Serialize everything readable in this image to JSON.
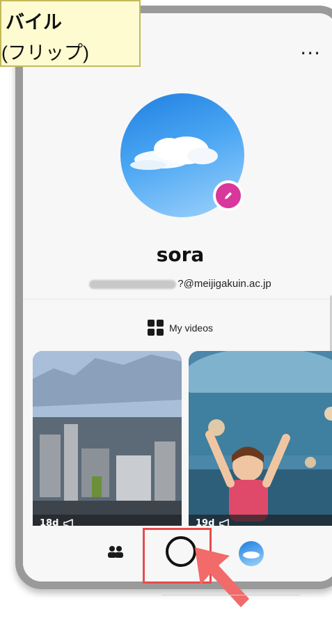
{
  "callout": {
    "line1": "バイル",
    "line2": "(フリップ)"
  },
  "profile": {
    "name": "sora",
    "email_suffix": "?@meijigakuin.ac.jp",
    "more_label": "..."
  },
  "tabs": {
    "my_videos": "My videos"
  },
  "videos": [
    {
      "age": "18d"
    },
    {
      "age": "19d"
    }
  ],
  "colors": {
    "accent": "#d9379b",
    "highlight": "#e84b4b",
    "callout_bg": "#fffbd0"
  },
  "icons": {
    "more": "more-icon",
    "edit": "pencil-icon",
    "grid": "grid-icon",
    "share": "megaphone-icon",
    "friends": "friends-icon",
    "record": "record-icon",
    "profile": "avatar-icon",
    "arrow": "arrow-icon"
  }
}
